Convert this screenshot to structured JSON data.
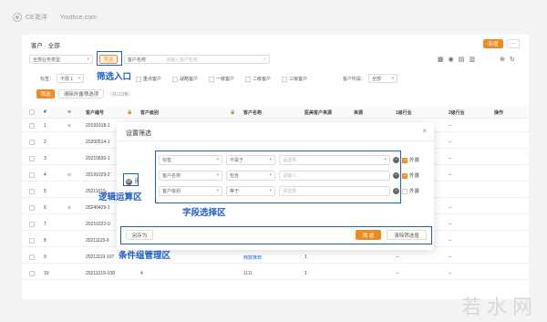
{
  "brand": {
    "name": "CE青洋",
    "site": "Youthce.com"
  },
  "header": {
    "title": "客户 · 全部",
    "new_btn": "新增",
    "more": "···"
  },
  "filterbar": {
    "category": "全部业务类型",
    "filter_btn": "筛选",
    "field": "客户名称",
    "search_placeholder": "请输入客户名称",
    "tag_label": "标签：",
    "tag_value": "不限 1",
    "checks": [
      "重点客户",
      "战略客户",
      "一级客户",
      "二级客户",
      "三级客户"
    ],
    "owner_label": "客户所属：",
    "owner_value": "全部",
    "apply_btn": "筛选",
    "clear_btn": "清除外露筛选项",
    "count": "（共119条）"
  },
  "table": {
    "headers": [
      "#",
      "客户编号",
      "客户级别",
      "客户名称",
      "医美客户来源",
      "来源",
      "1级行业",
      "2级行业",
      "操作"
    ],
    "rows": [
      {
        "n": "1",
        "code": "20191018-1",
        "level": "",
        "name": "",
        "src": "",
        "from": "",
        "i1": "--",
        "i2": "--"
      },
      {
        "n": "2",
        "code": "20200514-1",
        "level": "",
        "name": "",
        "src": "",
        "from": "",
        "i1": "--",
        "i2": "--"
      },
      {
        "n": "3",
        "code": "20210830-1",
        "level": "",
        "name": "",
        "src": "",
        "from": "",
        "i1": "--",
        "i2": "--"
      },
      {
        "n": "4",
        "code": "20191029-2",
        "level": "",
        "name": "",
        "src": "",
        "from": "",
        "i1": "--",
        "i2": "--"
      },
      {
        "n": "5",
        "code": "20211015-",
        "level": "",
        "name": "",
        "src": "",
        "from": "",
        "i1": "",
        "i2": ""
      },
      {
        "n": "6",
        "code": "20240429-1",
        "level": "",
        "name": "",
        "src": "",
        "from": "",
        "i1": "--",
        "i2": "--"
      },
      {
        "n": "7",
        "code": "20210222-0",
        "level": "",
        "name": "",
        "src": "",
        "from": "",
        "i1": "--",
        "i2": "--"
      },
      {
        "n": "8",
        "code": "20211115-0",
        "level": "",
        "name": "测试123",
        "src": "--",
        "from": "",
        "i1": "--",
        "i2": "--"
      },
      {
        "n": "9",
        "code": "20211119-107",
        "level": "3",
        "name": "韩数推荐",
        "src": "1",
        "from": "",
        "i1": "--",
        "i2": "--"
      },
      {
        "n": "10",
        "code": "20211219-108",
        "level": "4",
        "name": "1111",
        "src": "1",
        "from": "",
        "i1": "--",
        "i2": "--"
      }
    ]
  },
  "dialog": {
    "title": "设置筛选",
    "close": "×",
    "logic": "且",
    "conditions": [
      {
        "field": "标签",
        "op": "不属于",
        "value": "请选择",
        "expose": "外露",
        "checked": true
      },
      {
        "field": "客户名称",
        "op": "包含",
        "value": "请输入",
        "expose": "外露",
        "checked": true
      },
      {
        "field": "客户级别",
        "op": "等于",
        "value": "请选择",
        "expose": "外露",
        "checked": false
      }
    ],
    "save_as": "另存为",
    "ok": "筛 选",
    "clear": "清除筛选值"
  },
  "annotations": {
    "entry": "筛选入口",
    "logic": "逻辑运算区",
    "field": "字段选择区",
    "group": "条件组管理区"
  },
  "watermark": "若水网",
  "colors": {
    "accent": "#f08a24",
    "annotation": "#1f5fc6"
  }
}
